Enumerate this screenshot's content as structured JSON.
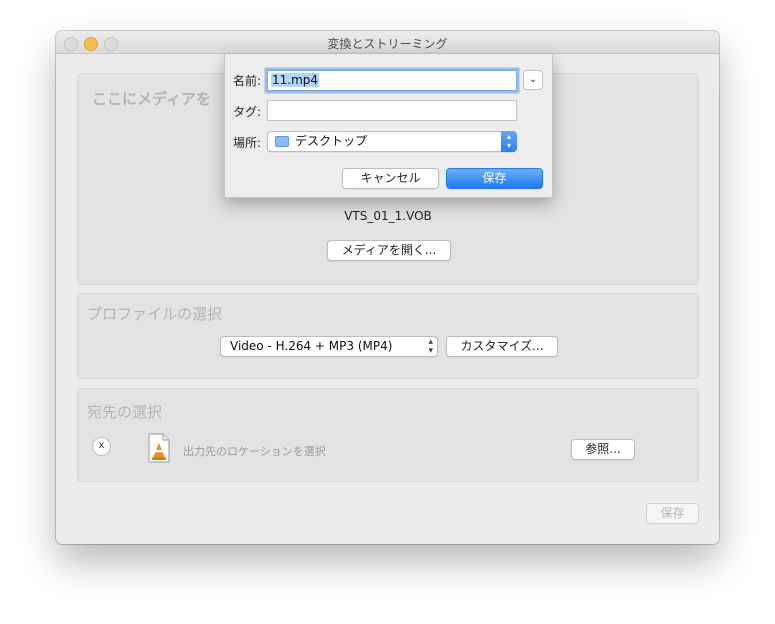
{
  "window": {
    "title": "変換とストリーミング"
  },
  "media_panel": {
    "heading": "ここにメディアを",
    "file_name": "VTS_01_1.VOB",
    "open_button": "メディアを開く..."
  },
  "profile_panel": {
    "heading": "プロファイルの選択",
    "selected_profile": "Video - H.264 + MP3 (MP4)",
    "customize_button": "カスタマイズ..."
  },
  "destination_panel": {
    "heading": "宛先の選択",
    "clear_button": "x",
    "placeholder_label": "出力先のロケーションを選択",
    "browse_button": "参照..."
  },
  "footer": {
    "save_button": "保存"
  },
  "save_sheet": {
    "name_label": "名前:",
    "name_value": "11.mp4",
    "tags_label": "タグ:",
    "tags_value": "",
    "where_label": "場所:",
    "where_value": "デスクトップ",
    "cancel_button": "キャンセル",
    "save_button": "保存"
  },
  "icons": {
    "expand": "chevron-down-icon",
    "folder": "folder-icon",
    "vlc": "vlc-cone-icon"
  },
  "colors": {
    "accent": "#2f7ff0",
    "window_bg": "#ececec",
    "panel_bg": "#e3e3e3"
  }
}
